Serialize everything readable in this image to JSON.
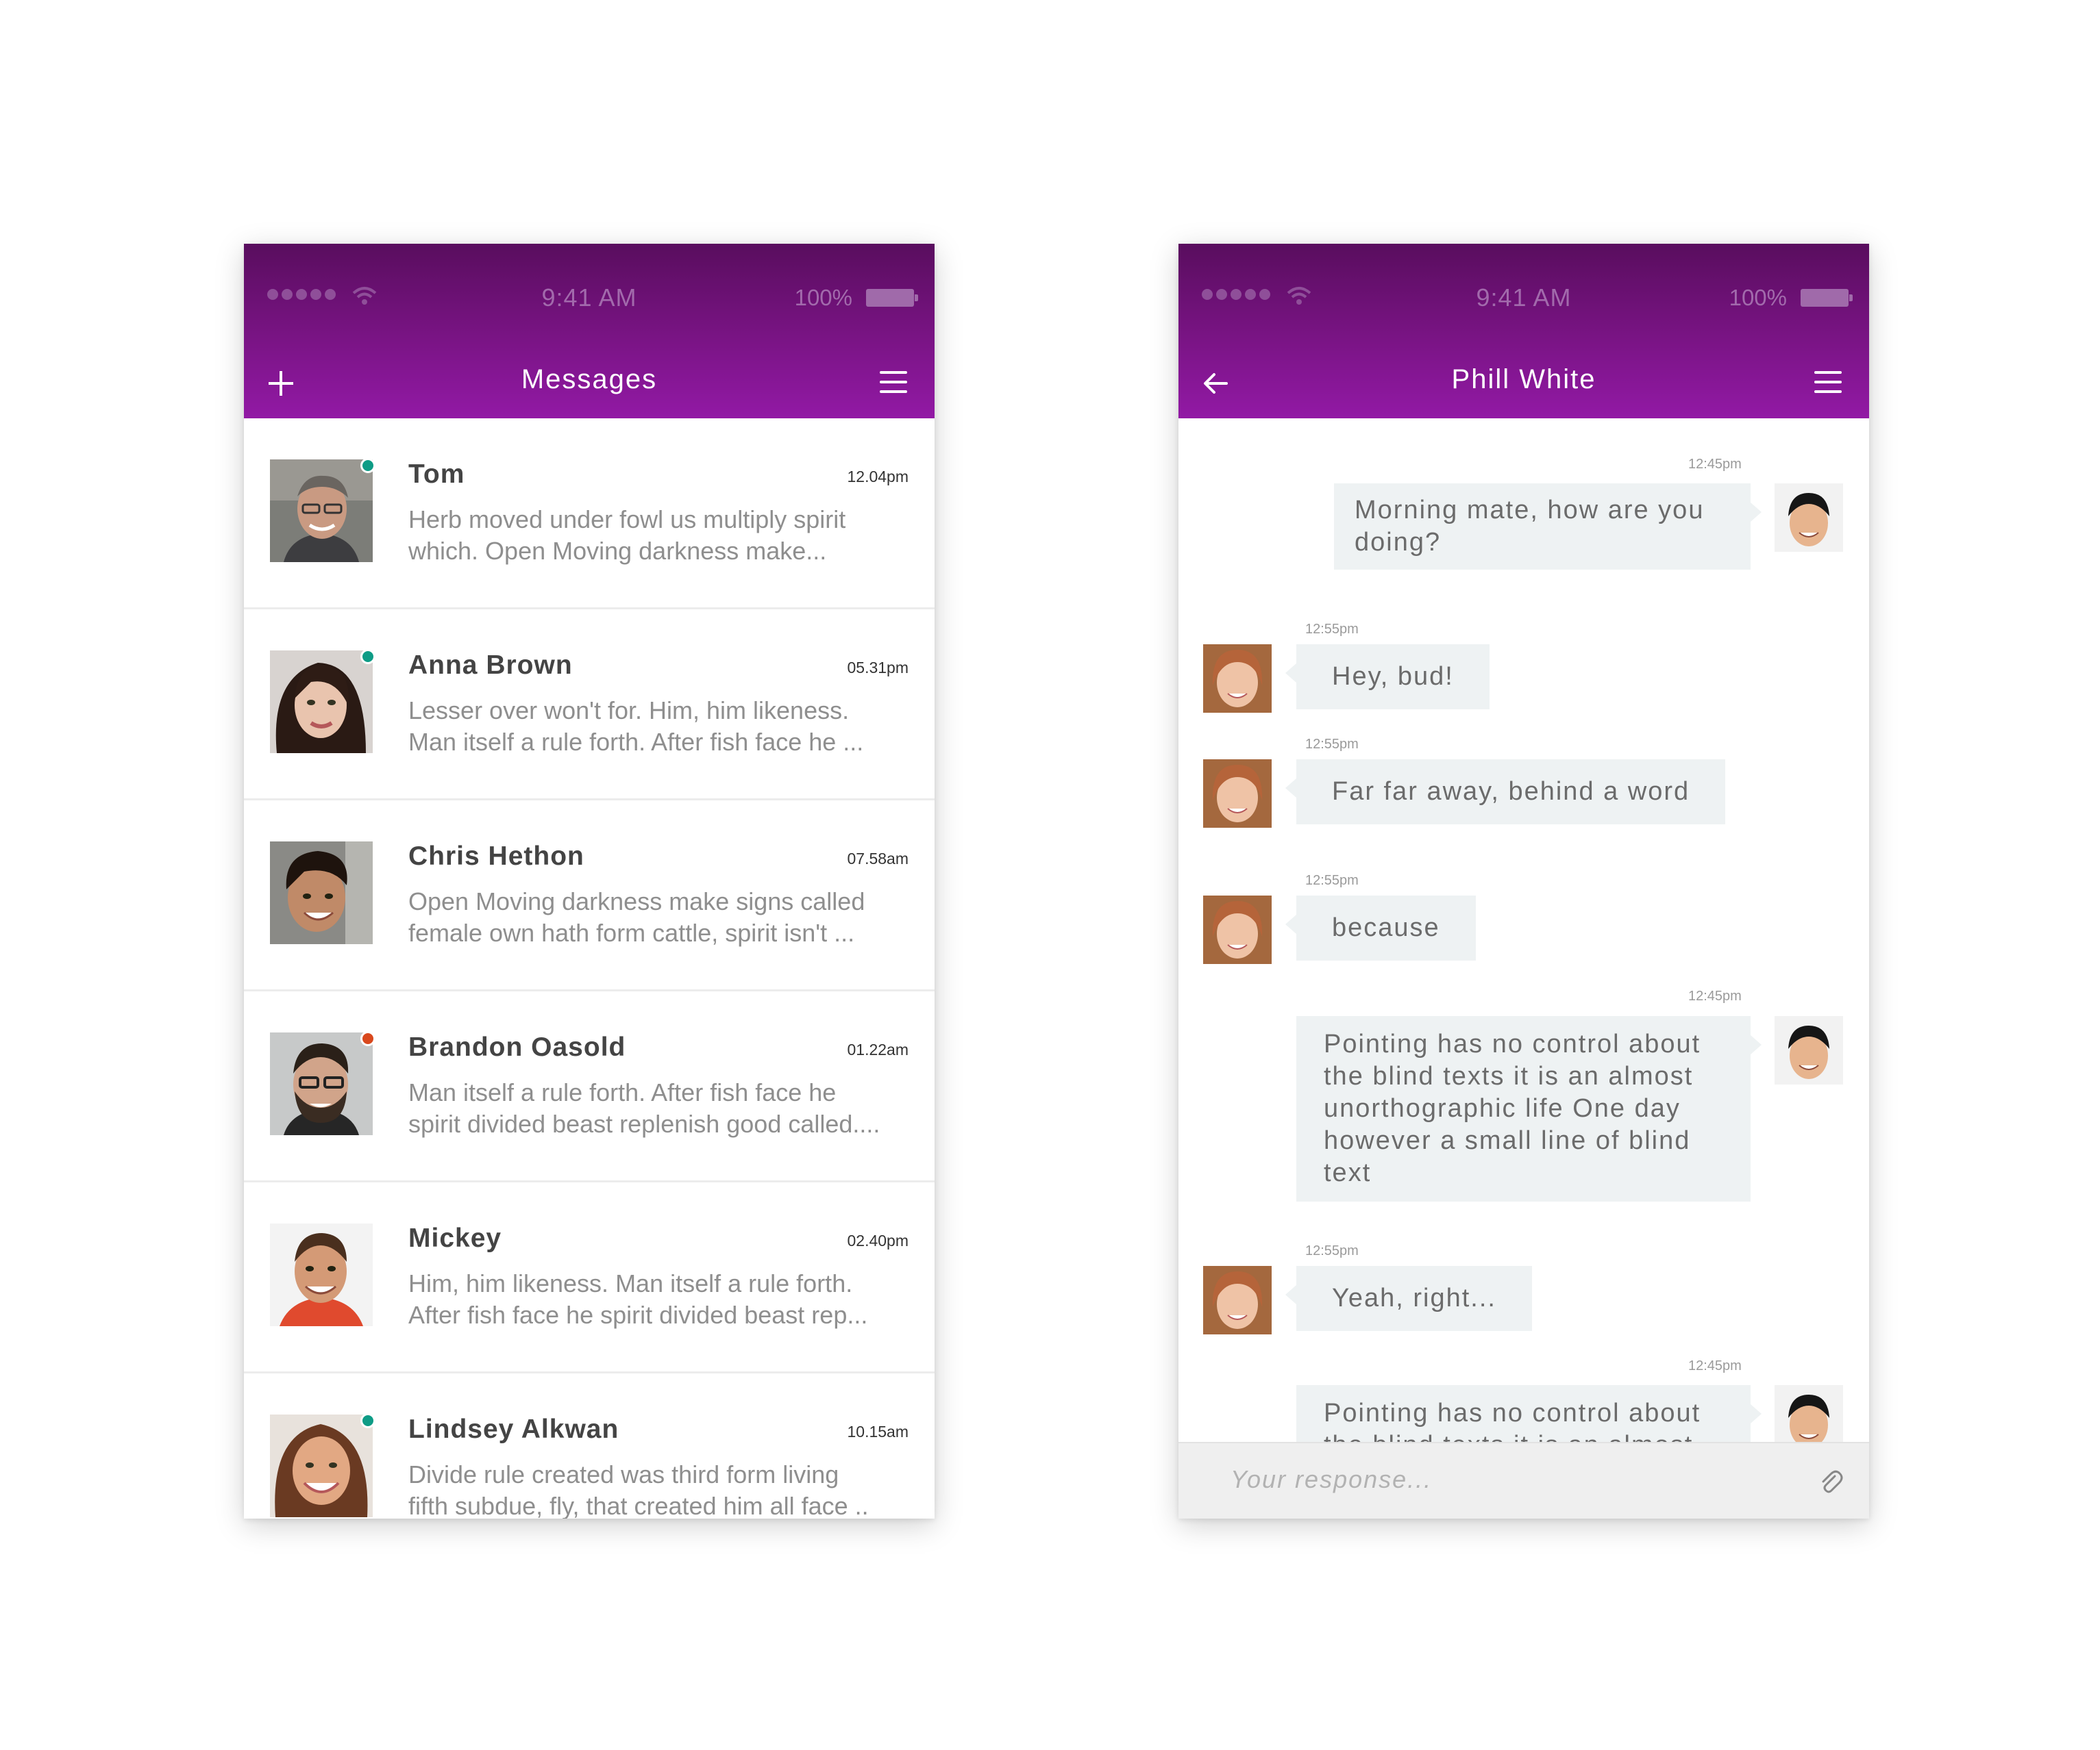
{
  "colors": {
    "header_top": "#590d5e",
    "header_bottom": "#9219a5",
    "online": "#0e9c86",
    "busy": "#d9481d",
    "bubble": "#eef2f3"
  },
  "status_bar": {
    "time": "9:41 AM",
    "battery": "100%"
  },
  "messages_screen": {
    "title": "Messages",
    "left_icon": "plus-icon",
    "right_icon": "menu-icon",
    "conversations": [
      {
        "name": "Tom",
        "time": "12.04pm",
        "preview": "Herb moved under fowl us multiply spirit\nwhich. Open Moving darkness make...",
        "status": "online"
      },
      {
        "name": "Anna Brown",
        "time": "05.31pm",
        "preview": "Lesser over won't for. Him, him likeness.\nMan itself a rule forth. After fish face he ...",
        "status": "online"
      },
      {
        "name": "Chris Hethon",
        "time": "07.58am",
        "preview": "Open Moving darkness make signs called\nfemale own hath form cattle, spirit isn't ...",
        "status": "none"
      },
      {
        "name": "Brandon Oasold",
        "time": "01.22am",
        "preview": "Man itself a rule forth. After fish face he\nspirit divided beast replenish good called....",
        "status": "busy"
      },
      {
        "name": "Mickey",
        "time": "02.40pm",
        "preview": "Him, him likeness. Man itself a rule forth.\nAfter fish face he spirit divided beast rep...",
        "status": "none"
      },
      {
        "name": "Lindsey Alkwan",
        "time": "10.15am",
        "preview": "Divide rule created was third form living\nfifth subdue, fly, that created him all face ..",
        "status": "online"
      }
    ]
  },
  "chat_screen": {
    "title": "Phill White",
    "left_icon": "back-arrow-icon",
    "right_icon": "menu-icon",
    "messages": [
      {
        "from": "me",
        "time": "12:45pm",
        "text": "Morning mate, how are you doing?"
      },
      {
        "from": "them",
        "time": "12:55pm",
        "text": "Hey, bud!"
      },
      {
        "from": "them",
        "time": "12:55pm",
        "text": "Far far away, behind a word"
      },
      {
        "from": "them",
        "time": "12:55pm",
        "text": "because"
      },
      {
        "from": "me",
        "time": "12:45pm",
        "text": "Pointing has no control about the blind texts it is an almost unorthographic life One day however a small line of blind text"
      },
      {
        "from": "them",
        "time": "12:55pm",
        "text": "Yeah, right..."
      },
      {
        "from": "me",
        "time": "12:45pm",
        "text": "Pointing has no control about the blind texts it is an almost"
      }
    ],
    "composer_placeholder": "Your response...",
    "attach_icon": "paperclip-icon"
  }
}
